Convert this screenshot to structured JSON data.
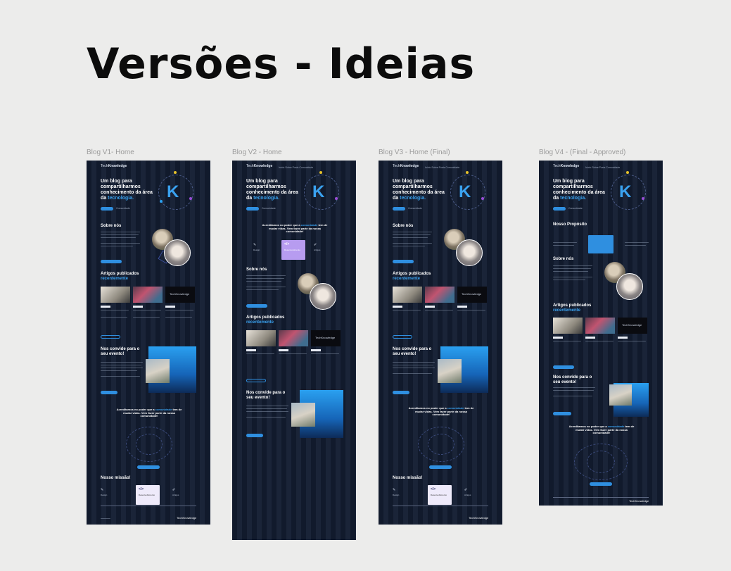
{
  "page": {
    "title": "Versões - Ideias"
  },
  "frames": [
    {
      "label": "Blog V1- Home"
    },
    {
      "label": "Blog V2 - Home"
    },
    {
      "label": "Blog V3 - Home (Final)"
    },
    {
      "label": "Blog V4 - (Final - Approved)"
    }
  ],
  "blog": {
    "logo_light": "Tech",
    "logo_bold": "Knowledge",
    "nav": "Início   Sobre   Posts   Comunidade",
    "hero_text": "Um blog para compartilharmos conhecimento da área da",
    "hero_accent": "tecnologia.",
    "hero_letter": "K",
    "hero_secondary_button": "Comunidade",
    "about_title": "Sobre nós",
    "articles_title_1": "Artigos publicados",
    "articles_title_2": "recentemente",
    "events_title_1": "Nos convide para o",
    "events_title_2": "seu evento!",
    "events_text": "Lorem ipsum has been the industry's standard dummy text ever since the 1500s, when an unknown printer took a galley of type and scrambled it to make a type specimen book.",
    "community_text_1": "Acreditamos no poder que a",
    "community_accent": "comunidade",
    "community_text_2": "tem de mudar vidas. Vem fazer parte da nossa comunidade!",
    "mission_title": "Nosso missão!",
    "purpose_title": "Nosso Propósito",
    "card_banner": "TechKnowledge",
    "services": [
      "Design",
      "Desenvolvimento",
      "Artigos"
    ],
    "code_icon": "</>",
    "footer_logo": "TechKnowledge"
  }
}
